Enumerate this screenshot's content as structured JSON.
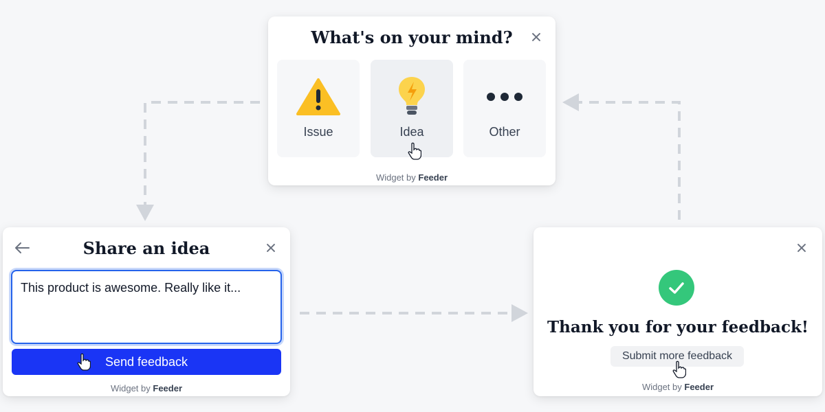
{
  "colors": {
    "accent": "#1a35f5",
    "focus_ring": "#2563eb",
    "success": "#34c77b",
    "warning": "#fbbf24",
    "bulb": "#fcd34d",
    "arrow": "#d1d5db"
  },
  "card_mind": {
    "title": "What's on your mind?",
    "options": [
      {
        "label": "Issue",
        "icon": "warning-icon"
      },
      {
        "label": "Idea",
        "icon": "lightbulb-icon"
      },
      {
        "label": "Other",
        "icon": "more-dots-icon"
      }
    ],
    "footer_prefix": "Widget by",
    "footer_brand": "Feeder"
  },
  "card_share": {
    "title": "Share an idea",
    "textarea_value": "This product is awesome. Really like it...",
    "send_label": "Send feedback",
    "footer_prefix": "Widget by",
    "footer_brand": "Feeder"
  },
  "card_thanks": {
    "message": "Thank you for your feedback!",
    "more_label": "Submit more feedback",
    "footer_prefix": "Widget by",
    "footer_brand": "Feeder"
  }
}
